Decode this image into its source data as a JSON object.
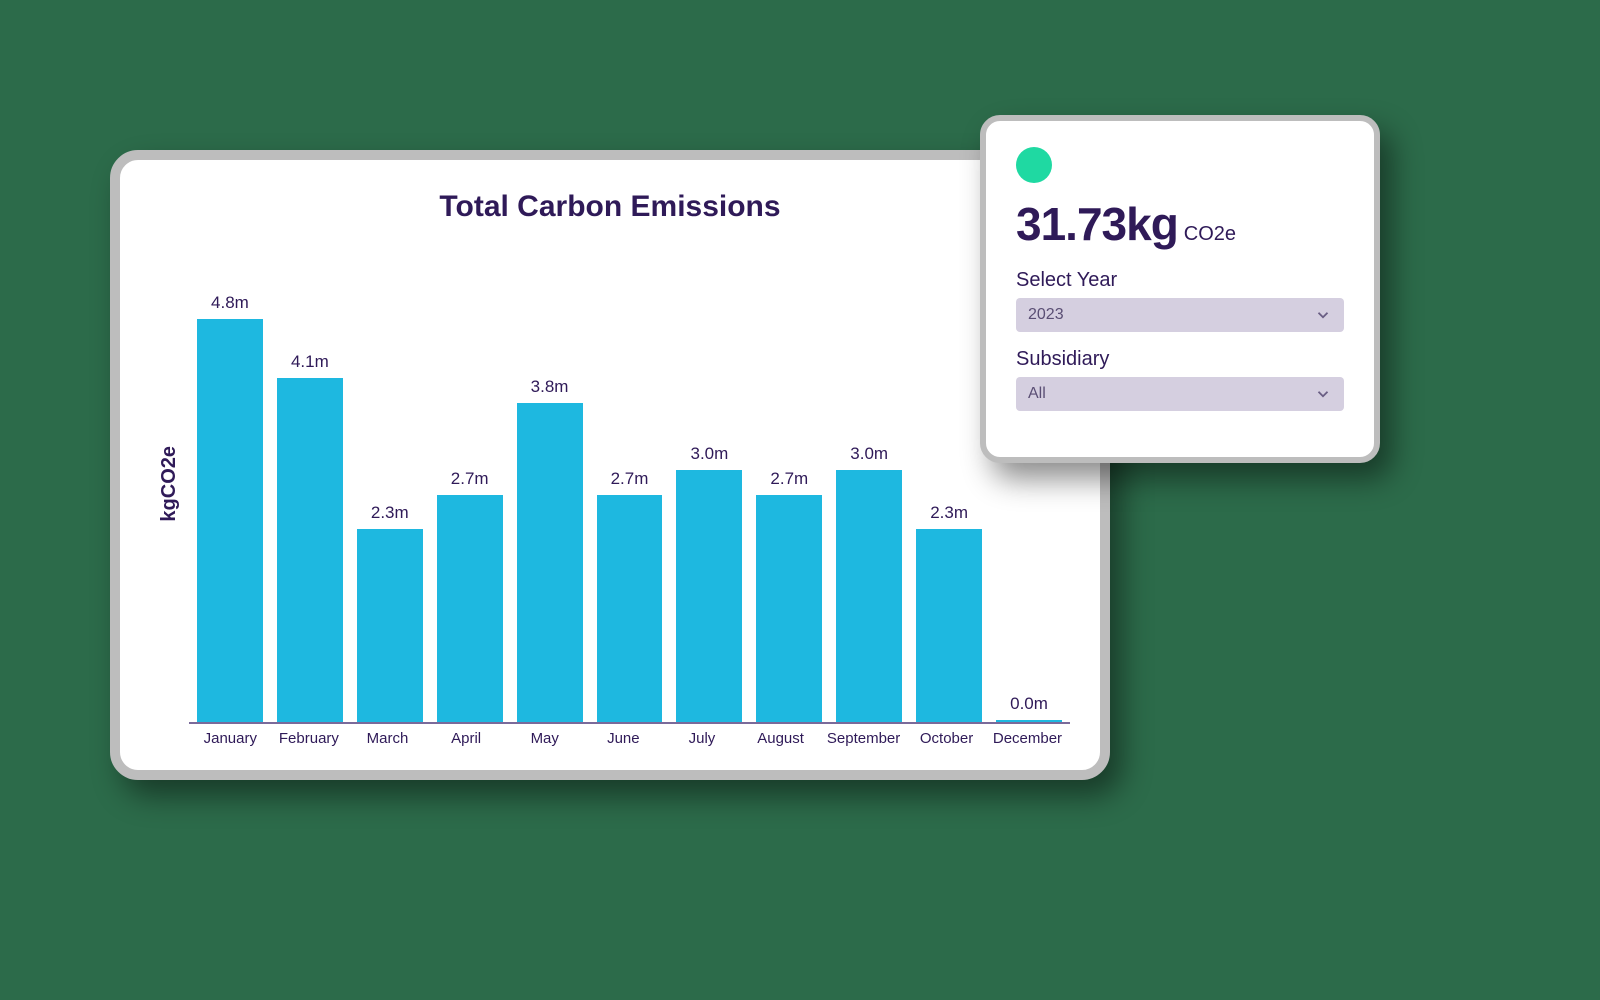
{
  "chart_data": {
    "type": "bar",
    "title": "Total Carbon Emissions",
    "ylabel": "kgCO2e",
    "xlabel": "",
    "ylim": [
      0,
      5.0
    ],
    "categories": [
      "January",
      "February",
      "March",
      "April",
      "May",
      "June",
      "July",
      "August",
      "September",
      "October",
      "December"
    ],
    "values": [
      4.8,
      4.1,
      2.3,
      2.7,
      3.8,
      2.7,
      3.0,
      2.7,
      3.0,
      2.3,
      0.0
    ],
    "value_labels": [
      "4.8m",
      "4.1m",
      "2.3m",
      "2.7m",
      "3.8m",
      "2.7m",
      "3.0m",
      "2.7m",
      "3.0m",
      "2.3m",
      "0.0m"
    ]
  },
  "side_panel": {
    "total_value": "31.73kg",
    "total_unit": "CO2e",
    "year": {
      "label": "Select Year",
      "value": "2023"
    },
    "subsidiary": {
      "label": "Subsidiary",
      "value": "All"
    }
  },
  "colors": {
    "bar": "#1eb8e0",
    "dot": "#1fd9a2",
    "text": "#2f1a58",
    "select_bg": "#d5cfe0"
  }
}
